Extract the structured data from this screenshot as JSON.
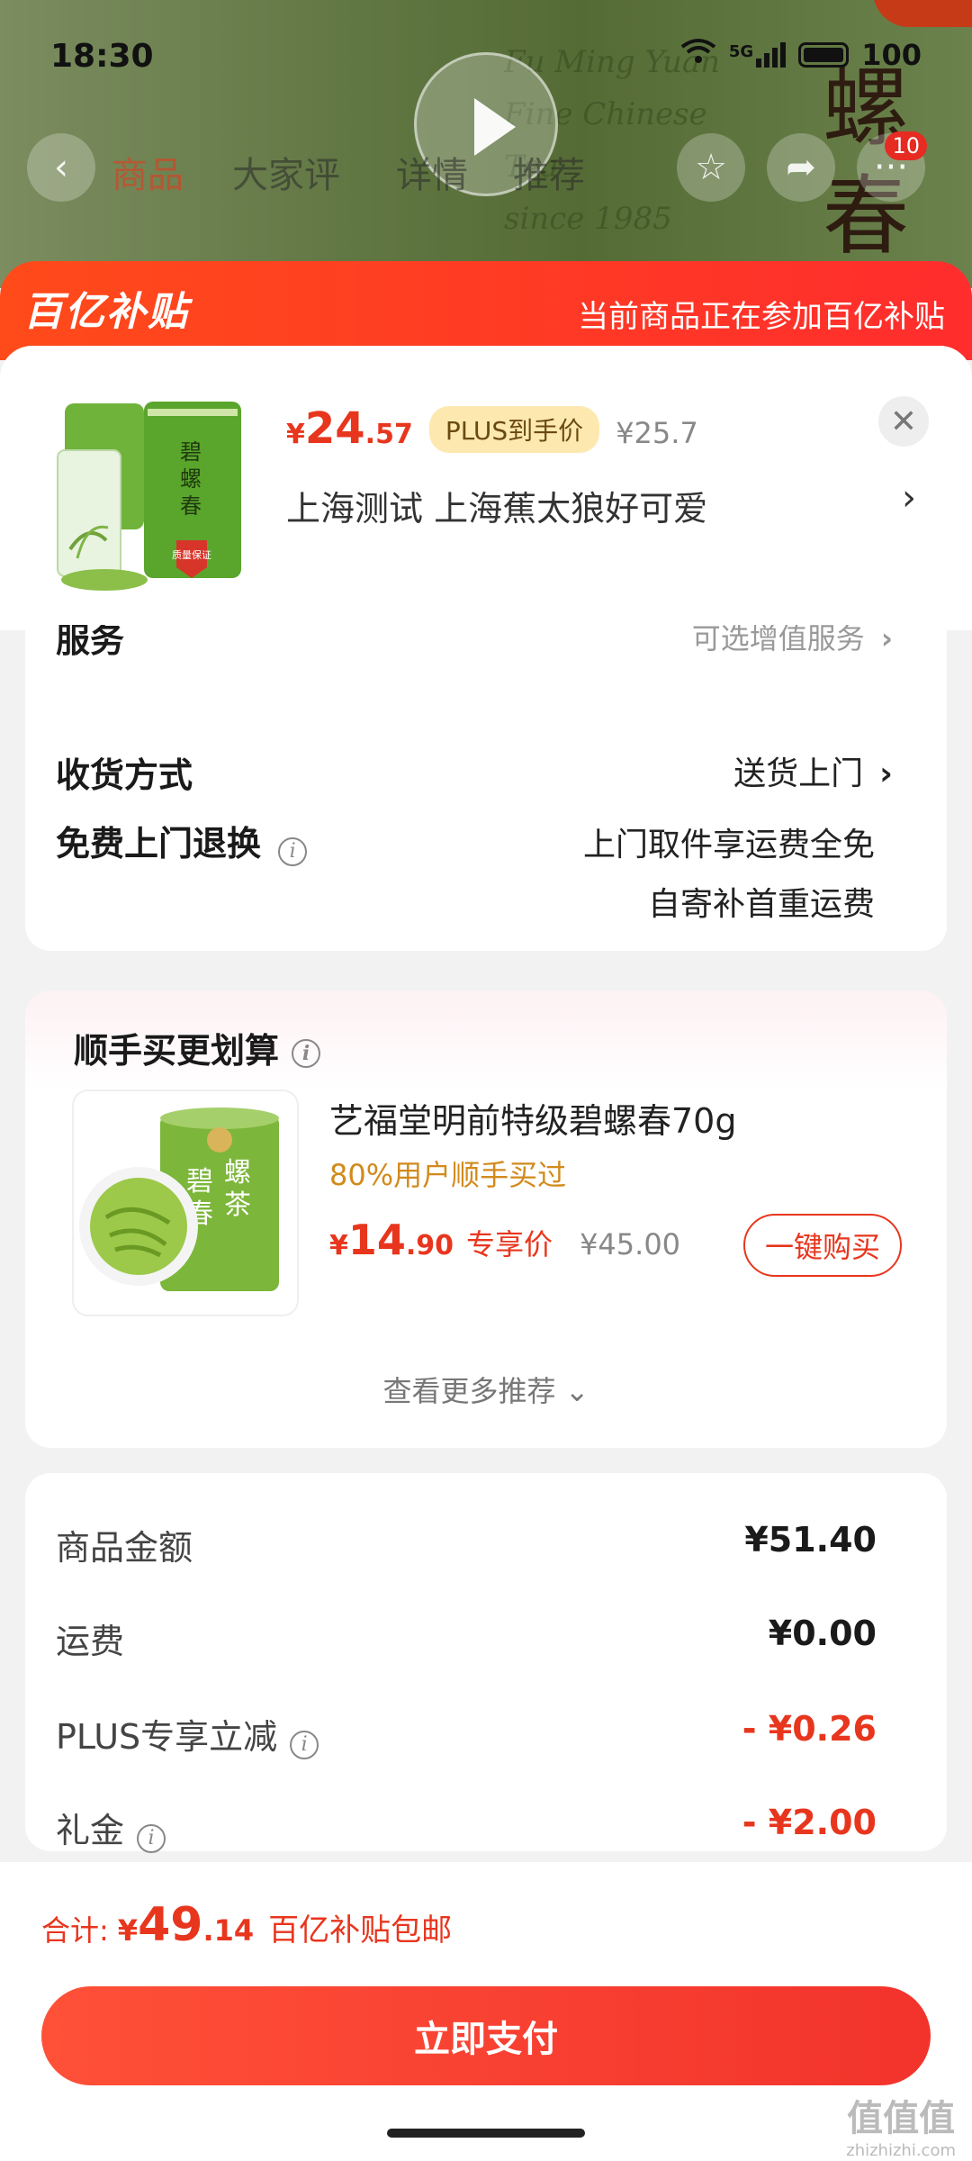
{
  "status": {
    "time": "18:30",
    "signal": "5G",
    "battery": "100"
  },
  "background": {
    "can_lines": [
      "Fu Ming Yuan",
      "Fine Chinese Tea",
      "since 1985"
    ],
    "big_chars": [
      "螺",
      "春"
    ],
    "nav_tabs": [
      "商品",
      "大家评",
      "详情",
      "推荐"
    ],
    "cart_badge": "10"
  },
  "subsidy": {
    "logo": "百亿补贴",
    "message": "当前商品正在参加百亿补贴"
  },
  "product": {
    "price_currency": "¥",
    "price_int": "24",
    "price_dec": ".57",
    "plus_tag": "PLUS到手价",
    "original_price": "¥25.7",
    "address": "上海测试  上海蕉太狼好可爱",
    "thumb_text": [
      "碧",
      "螺",
      "春"
    ],
    "thumb_badge": "质量保证"
  },
  "options": {
    "service_label": "服务",
    "service_value": "可选增值服务",
    "delivery_label": "收货方式",
    "delivery_value": "送货上门",
    "return_label": "免费上门退换",
    "return_value_1": "上门取件享运费全免",
    "return_value_2": "自寄补首重运费"
  },
  "recommend": {
    "title": "顺手买更划算",
    "name": "艺福堂明前特级碧螺春70g",
    "sold": "80%用户顺手买过",
    "price_currency": "¥",
    "price_int": "14",
    "price_dec": ".90",
    "tag": "专享价",
    "old_price": "¥45.00",
    "buy_label": "一键购买",
    "more_label": "查看更多推荐",
    "thumb_text": [
      "碧",
      "螺",
      "春",
      "茶"
    ]
  },
  "summary": [
    {
      "label": "商品金额",
      "value": "¥51.40"
    },
    {
      "label": "运费",
      "value": "¥0.00"
    },
    {
      "label": "PLUS专享立减",
      "value": "- ¥0.26"
    },
    {
      "label": "礼金",
      "value": "- ¥2.00"
    }
  ],
  "footer": {
    "total_label": "合计:",
    "total_currency": "¥",
    "total_int": "49",
    "total_dec": ".14",
    "total_note": "百亿补贴包邮",
    "pay_label": "立即支付"
  },
  "watermark": {
    "text": "值值值",
    "url": "zhizhizhi.com"
  },
  "colors": {
    "accent_red": "#e8361e",
    "plus_gold": "#fde9b0",
    "sold_orange": "#d28a1b"
  }
}
